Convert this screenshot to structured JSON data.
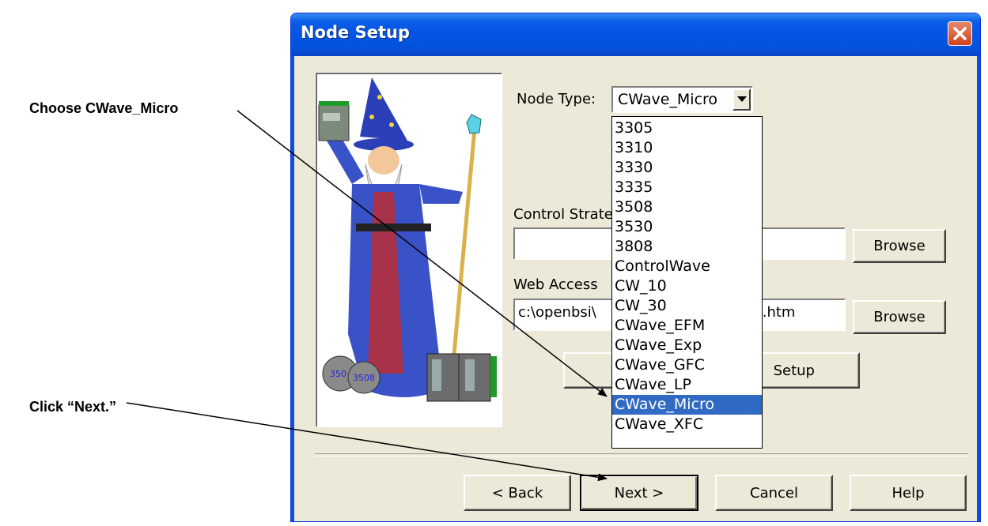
{
  "callouts": {
    "choose": "Choose CWave_Micro",
    "click_next": "Click “Next.”"
  },
  "dialog": {
    "title": "Node Setup",
    "node_type_label": "Node Type:",
    "node_type_value": "CWave_Micro",
    "control_strategy_label": "Control Strate",
    "control_strategy_value": "",
    "web_access_label": "Web Access",
    "web_access_value_left": "c:\\openbsi\\",
    "web_access_value_right": "SI.htm",
    "browse_label": "Browse",
    "setup_label": "Setup",
    "dropdown_options": [
      "3305",
      "3310",
      "3330",
      "3335",
      "3508",
      "3530",
      "3808",
      "ControlWave",
      "CW_10",
      "CW_30",
      "CWave_EFM",
      "CWave_Exp",
      "CWave_GFC",
      "CWave_LP",
      "CWave_Micro",
      "CWave_XFC"
    ],
    "selected_option": "CWave_Micro",
    "buttons": {
      "back": "< Back",
      "next": "Next >",
      "cancel": "Cancel",
      "help": "Help"
    },
    "wizard_badges": [
      "350",
      "3508"
    ]
  },
  "colors": {
    "titlebar": "#0554e3",
    "selection": "#316ac5",
    "dialog_bg": "#ece9d8"
  }
}
